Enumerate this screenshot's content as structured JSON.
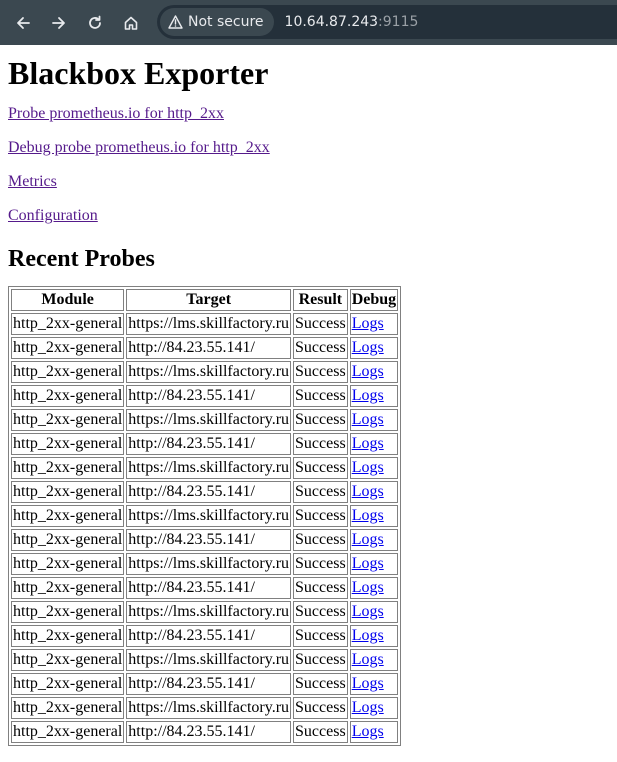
{
  "browser": {
    "security_label": "Not secure",
    "url_host": "10.64.87.243",
    "url_port": ":9115"
  },
  "page": {
    "title": "Blackbox Exporter",
    "links": [
      "Probe prometheus.io for http_2xx",
      "Debug probe prometheus.io for http_2xx",
      "Metrics",
      "Configuration"
    ],
    "recent_heading": "Recent Probes"
  },
  "table": {
    "headers": [
      "Module",
      "Target",
      "Result",
      "Debug"
    ],
    "rows": [
      [
        "http_2xx-general",
        "https://lms.skillfactory.ru",
        "Success",
        "Logs"
      ],
      [
        "http_2xx-general",
        "http://84.23.55.141/",
        "Success",
        "Logs"
      ],
      [
        "http_2xx-general",
        "https://lms.skillfactory.ru",
        "Success",
        "Logs"
      ],
      [
        "http_2xx-general",
        "http://84.23.55.141/",
        "Success",
        "Logs"
      ],
      [
        "http_2xx-general",
        "https://lms.skillfactory.ru",
        "Success",
        "Logs"
      ],
      [
        "http_2xx-general",
        "http://84.23.55.141/",
        "Success",
        "Logs"
      ],
      [
        "http_2xx-general",
        "https://lms.skillfactory.ru",
        "Success",
        "Logs"
      ],
      [
        "http_2xx-general",
        "http://84.23.55.141/",
        "Success",
        "Logs"
      ],
      [
        "http_2xx-general",
        "https://lms.skillfactory.ru",
        "Success",
        "Logs"
      ],
      [
        "http_2xx-general",
        "http://84.23.55.141/",
        "Success",
        "Logs"
      ],
      [
        "http_2xx-general",
        "https://lms.skillfactory.ru",
        "Success",
        "Logs"
      ],
      [
        "http_2xx-general",
        "http://84.23.55.141/",
        "Success",
        "Logs"
      ],
      [
        "http_2xx-general",
        "https://lms.skillfactory.ru",
        "Success",
        "Logs"
      ],
      [
        "http_2xx-general",
        "http://84.23.55.141/",
        "Success",
        "Logs"
      ],
      [
        "http_2xx-general",
        "https://lms.skillfactory.ru",
        "Success",
        "Logs"
      ],
      [
        "http_2xx-general",
        "http://84.23.55.141/",
        "Success",
        "Logs"
      ],
      [
        "http_2xx-general",
        "https://lms.skillfactory.ru",
        "Success",
        "Logs"
      ],
      [
        "http_2xx-general",
        "http://84.23.55.141/",
        "Success",
        "Logs"
      ]
    ]
  },
  "colors": {
    "chrome_bg": "#3b4850",
    "visited_link": "#551a8b",
    "link": "#0000ee"
  },
  "icons": [
    "back-icon",
    "forward-icon",
    "reload-icon",
    "home-icon",
    "warning-icon"
  ]
}
